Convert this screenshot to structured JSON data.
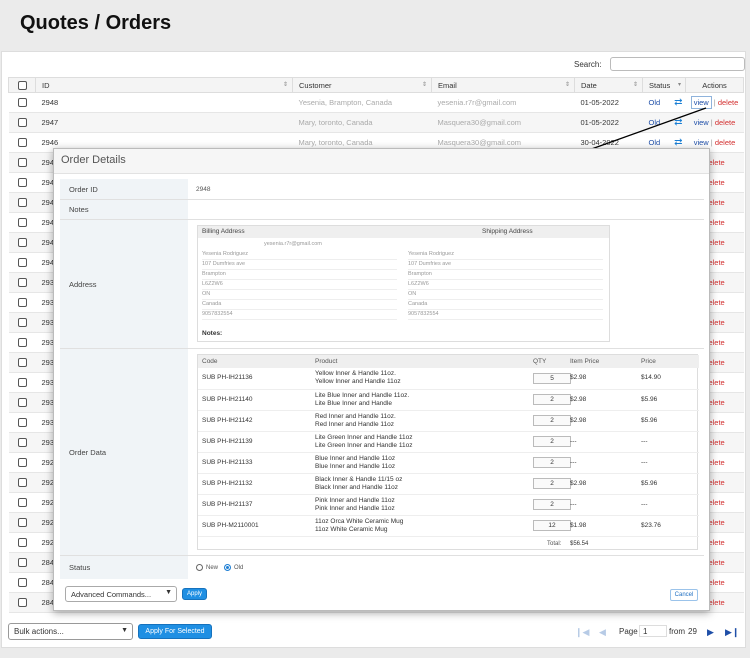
{
  "page": {
    "title": "Quotes / Orders"
  },
  "search": {
    "label": "Search:",
    "value": ""
  },
  "table": {
    "headers": {
      "id": "ID",
      "customer": "Customer",
      "email": "Email",
      "date": "Date",
      "status": "Status",
      "actions": "Actions"
    },
    "top_rows": [
      {
        "id": "2948",
        "customer": "Yesenia, Brampton, Canada",
        "email": "yesenia.r7r@gmail.com",
        "date": "01-05-2022",
        "status": "Old"
      },
      {
        "id": "2947",
        "customer": "Mary, toronto, Canada",
        "email": "Masquera30@gmail.com",
        "date": "01-05-2022",
        "status": "Old"
      },
      {
        "id": "2946",
        "customer": "Mary, toronto, Canada",
        "email": "Masquera30@gmail.com",
        "date": "30-04-2022",
        "status": "Old"
      }
    ],
    "partial_ids": [
      "294",
      "294",
      "294",
      "294",
      "294",
      "294",
      "293",
      "293",
      "293",
      "293",
      "293",
      "293",
      "293",
      "293",
      "293",
      "292",
      "292",
      "292",
      "292",
      "292",
      "284",
      "284",
      "284"
    ],
    "view_label": "view",
    "delete_label": "delete",
    "separator": "|"
  },
  "footer": {
    "bulk_label": "Bulk actions...",
    "apply_selected": "Apply For Selected",
    "page_label": "Page",
    "page_current": "1",
    "from_label": "from",
    "page_total": "29"
  },
  "modal": {
    "title": "Order Details",
    "order_id_label": "Order ID",
    "order_id": "2948",
    "notes_label": "Notes",
    "address_label": "Address",
    "billing_header": "Billing Address",
    "shipping_header": "Shipping Address",
    "billing_email": "yesenia.r7r@gmail.com",
    "billing": [
      "Yesenia Rodriguez",
      "107 Dumfries ave",
      "Brampton",
      "L6Z2W6",
      "ON",
      "Canada",
      "9057832554"
    ],
    "shipping": [
      "Yesenia Rodriguez",
      "107 Dumfries ave",
      "Brampton",
      "L6Z2W6",
      "ON",
      "Canada",
      "9057832554"
    ],
    "addr_notes_label": "Notes:",
    "order_data_label": "Order Data",
    "items_headers": {
      "code": "Code",
      "product": "Product",
      "qty": "QTY",
      "item_price": "Item Price",
      "price": "Price"
    },
    "items": [
      {
        "code": "SUB PH-IH21136",
        "p1": "Yellow Inner & Handle 11oz.",
        "p2": "Yellow Inner and Handle 11oz",
        "qty": "5",
        "item_price": "$2.98",
        "price": "$14.90"
      },
      {
        "code": "SUB PH-IH21140",
        "p1": "Lite Blue Inner and Handle 11oz.",
        "p2": "Lite Blue Inner and Handle",
        "qty": "2",
        "item_price": "$2.98",
        "price": "$5.96"
      },
      {
        "code": "SUB PH-IH21142",
        "p1": "Red Inner and Handle 11oz.",
        "p2": "Red Inner and Handle 11oz",
        "qty": "2",
        "item_price": "$2.98",
        "price": "$5.96"
      },
      {
        "code": "SUB PH-IH21139",
        "p1": "Lite Green Inner and Handle 11oz",
        "p2": "Lite Green Inner and Handle 11oz",
        "qty": "2",
        "item_price": "---",
        "price": "---"
      },
      {
        "code": "SUB PH-IH21133",
        "p1": "Blue Inner and Handle 11oz",
        "p2": "Blue Inner and Handle 11oz",
        "qty": "2",
        "item_price": "---",
        "price": "---"
      },
      {
        "code": "SUB PH-IH21132",
        "p1": "Black Inner & Handle 11/15 oz",
        "p2": "Black Inner and Handle 11oz",
        "qty": "2",
        "item_price": "$2.98",
        "price": "$5.96"
      },
      {
        "code": "SUB PH-IH21137",
        "p1": "Pink Inner and Handle 11oz",
        "p2": "Pink Inner and Handle 11oz",
        "qty": "2",
        "item_price": "---",
        "price": "---"
      },
      {
        "code": "SUB PH-M2110001",
        "p1": "11oz Orca White Ceramic Mug",
        "p2": "11oz White Ceramic Mug",
        "qty": "12",
        "item_price": "$1.98",
        "price": "$23.76"
      }
    ],
    "total_label": "Total:",
    "total": "$56.54",
    "status_label": "Status",
    "status_new": "New",
    "status_old": "Old",
    "advanced_label": "Advanced Commands...",
    "apply_label": "Apply",
    "cancel_label": "Cancel"
  }
}
